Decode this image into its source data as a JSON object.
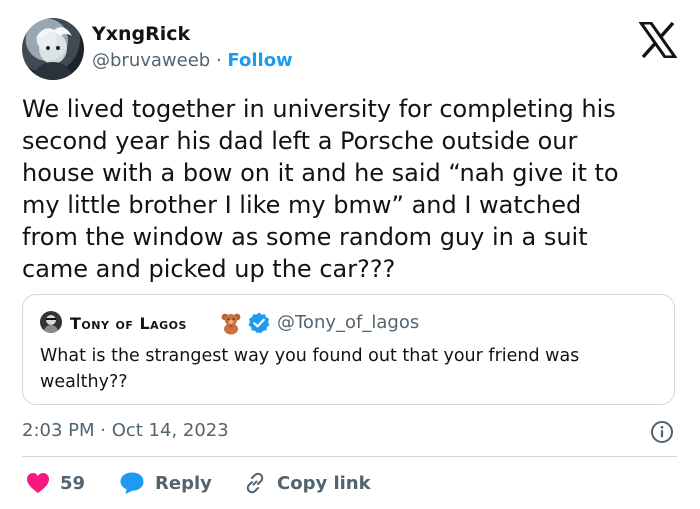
{
  "author": {
    "name": "YxngRick",
    "handle": "@bruvaweeb",
    "separator": "·",
    "follow_label": "Follow",
    "avatar_icon": "profile-avatar"
  },
  "tweet": {
    "text": "We lived together in university for completing his\nsecond year his dad left a Porsche outside our\nhouse with a bow on it and he said “nah give it to\nmy little brother I like my bmw” and I watched\nfrom the window as some random guy in a suit\ncame and picked up the car???"
  },
  "quoted": {
    "name": "Tony of Lagos",
    "handle": "@Tony_of_lagos",
    "text": "What is the strangest way you found out that your friend was\nwealthy??",
    "emoji_icon": "teddy-bear-icon",
    "verified_icon": "verified-badge-icon"
  },
  "meta": {
    "timestamp": "2:03 PM · Oct 14, 2023"
  },
  "actions": {
    "likes": "59",
    "reply_label": "Reply",
    "copy_label": "Copy link"
  },
  "colors": {
    "accent": "#1d9bf0",
    "like": "#f91880",
    "text": "#0f1419",
    "muted": "#536471",
    "border": "#cfd9de"
  }
}
